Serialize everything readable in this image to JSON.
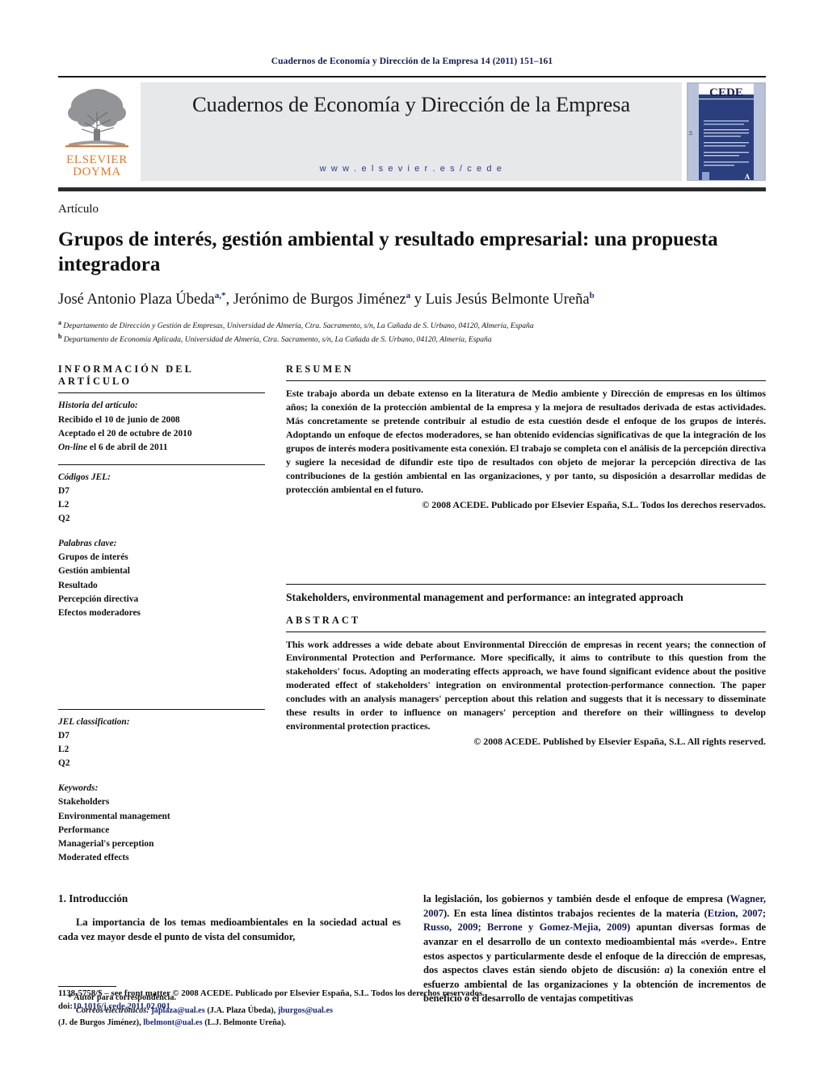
{
  "runninghead": "Cuadernos de Economía y Dirección de la Empresa 14 (2011) 151–161",
  "masthead": {
    "publisher_logo_line1": "ELSEVIER",
    "publisher_logo_line2": "DOYMA",
    "publisher_logo_icon": "elsevier-tree-icon",
    "journal_title": "Cuadernos de Economía y Dirección de la Empresa",
    "journal_url": "w w w . e l s e v i e r . e s / c e d e",
    "cover_title": "CEDE",
    "cover_subtitle": "Cuadernos de Economía y Dirección de la Empresa",
    "cover_volume": "14",
    "cover_issue": "1"
  },
  "article": {
    "kicker": "Artículo",
    "title": "Grupos de interés, gestión ambiental y resultado empresarial: una propuesta integradora",
    "authors_html": "José Antonio Plaza Úbeda<sup>a,*</sup>,  Jerónimo de Burgos Jiménez<sup>a</sup> y Luis Jesús Belmonte Ureña<sup>b</sup>",
    "affiliations": [
      {
        "marker": "a",
        "text": "Departamento de Dirección y Gestión de Empresas, Universidad de Almería, Ctra. Sacramento, s/n, La Cañada de S. Urbano, 04120, Almería, España"
      },
      {
        "marker": "b",
        "text": "Departamento de Economía Aplicada, Universidad de Almería, Ctra. Sacramento, s/n, La Cañada de S. Urbano, 04120, Almería, España"
      }
    ]
  },
  "infopanel": {
    "heading": "INFORMACIÓN DEL ARTÍCULO",
    "history_label": "Historia del artículo:",
    "history": [
      "Recibido el 10 de junio de 2008",
      "Aceptado el 20 de octubre de 2010"
    ],
    "online_prefix": "On-line",
    "online_rest": " el 6 de abril de 2011",
    "jel_label_es": "Códigos JEL:",
    "jel_codes_es": [
      "D7",
      "L2",
      "Q2"
    ],
    "keywords_label_es": "Palabras clave:",
    "keywords_es": [
      "Grupos de interés",
      "Gestión ambiental",
      "Resultado",
      "Percepción directiva",
      "Efectos moderadores"
    ],
    "jel_label_en": "JEL classification:",
    "jel_codes_en": [
      "D7",
      "L2",
      "Q2"
    ],
    "keywords_label_en": "Keywords:",
    "keywords_en": [
      "Stakeholders",
      "Environmental management",
      "Performance",
      "Managerial's perception",
      "Moderated effects"
    ]
  },
  "resumen": {
    "heading": "RESUMEN",
    "body": "Este trabajo aborda un debate extenso en la literatura de Medio ambiente y Dirección de empresas en los últimos años; la conexión de la protección ambiental de la empresa y la mejora de resultados derivada de estas actividades. Más concretamente se pretende contribuir al estudio de esta cuestión desde el enfoque de los grupos de interés. Adoptando un enfoque de efectos moderadores, se han obtenido evidencias significativas de que la integración de los grupos de interés modera positivamente esta conexión. El trabajo se completa con el análisis de la percepción directiva y sugiere la necesidad de difundir este tipo de resultados con objeto de mejorar la percepción directiva de las contribuciones de la gestión ambiental en las organizaciones, y por tanto, su disposición a desarrollar medidas de protección ambiental en el futuro.",
    "copyright": "© 2008 ACEDE. Publicado por Elsevier España, S.L. Todos los derechos reservados."
  },
  "abstract": {
    "title": "Stakeholders, environmental management and performance: an integrated approach",
    "heading": "ABSTRACT",
    "body": "This work addresses a wide debate about Environmental Dirección de empresas in recent years; the connection of Environmental Protection and Performance. More specifically, it aims to contribute to this question from the stakeholders' focus. Adopting an moderating effects approach, we have found significant evidence about the positive moderated effect of stakeholders' integration on environmental protection-performance connection. The paper concludes with an analysis managers' perception about this relation and suggests that it is necessary to disseminate these results in order to influence on managers' perception and therefore on their willingness to develop environmental protection practices.",
    "copyright": "© 2008 ACEDE. Published by Elsevier España, S.L. All rights reserved."
  },
  "intro": {
    "heading": "1.  Introducción",
    "left_paragraph": "La importancia de los temas medioambientales en la sociedad actual es cada vez mayor desde el punto de vista del consumidor,",
    "right_paragraph_pre": "la legislación, los gobiernos y también desde el enfoque de empresa (",
    "right_cite_1": "Wagner, 2007",
    "right_mid_1": "). En esta línea distintos trabajos recientes de la materia (",
    "right_cite_2": "Etzion, 2007; Russo, 2009; Berrone y Gomez-Mejia, 2009",
    "right_mid_2": ") apuntan diversas formas de avanzar en el desarrollo de un contexto medioambiental más «verde». Entre estos aspectos y particularmente desde el enfoque de la dirección de empresas, dos aspectos claves están siendo objeto de discusión: ",
    "right_italic_a": "a",
    "right_tail": ") la conexión entre el esfuerzo ambiental de las organizaciones y la obtención de incrementos de beneficio o el desarrollo de ventajas competitivas"
  },
  "footnote": {
    "star": "*",
    "corresponding": "Autor para correspondencia.",
    "emails_label": "Correos electrónicos:",
    "email1": "japlaza@ual.es",
    "email1_owner": " (J.A. Plaza Úbeda), ",
    "email2": "jburgos@ual.es",
    "email2_owner": " (J. de Burgos Jiménez), ",
    "email3": "lbelmont@ual.es",
    "email3_owner": " (L.J. Belmonte Ureña)."
  },
  "footer": {
    "line1": "1138-5758/$ – see front matter © 2008 ACEDE. Publicado por Elsevier España, S.L. Todos los derechos reservados.",
    "doi_label": "doi:",
    "doi_value": "10.1016/j.cede.2011.02.001"
  },
  "colors": {
    "navy": "#151a52",
    "link_blue": "#1b2a7a",
    "elsevier_orange": "#e87722",
    "band_gray": "#e7e8ea",
    "cover_blue": "#2b3e7e"
  }
}
